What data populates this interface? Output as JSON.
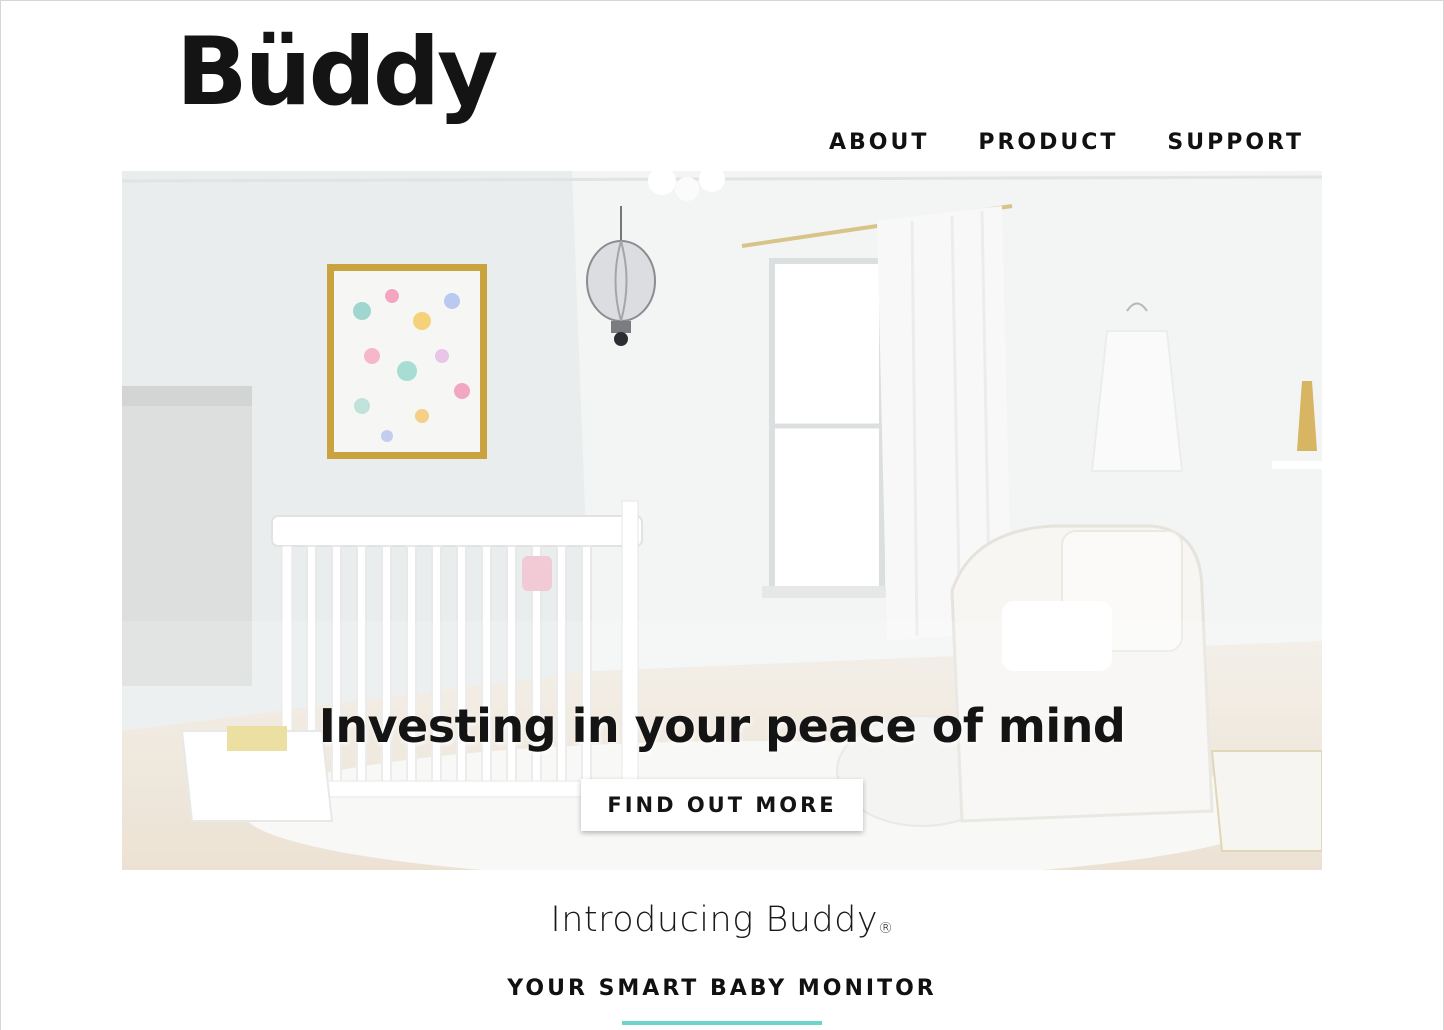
{
  "brand": {
    "logo_text": "Büddy"
  },
  "nav": {
    "items": [
      {
        "label": "ABOUT"
      },
      {
        "label": "PRODUCT"
      },
      {
        "label": "SUPPORT"
      }
    ]
  },
  "hero": {
    "headline": "Investing in your peace of mind",
    "cta_label": "FIND OUT MORE"
  },
  "intro": {
    "title": "Introducing Buddy",
    "registered_mark": "®",
    "tagline": "YOUR SMART BABY MONITOR"
  },
  "colors": {
    "accent": "#6fd3c9",
    "text": "#141414",
    "background": "#ffffff"
  }
}
